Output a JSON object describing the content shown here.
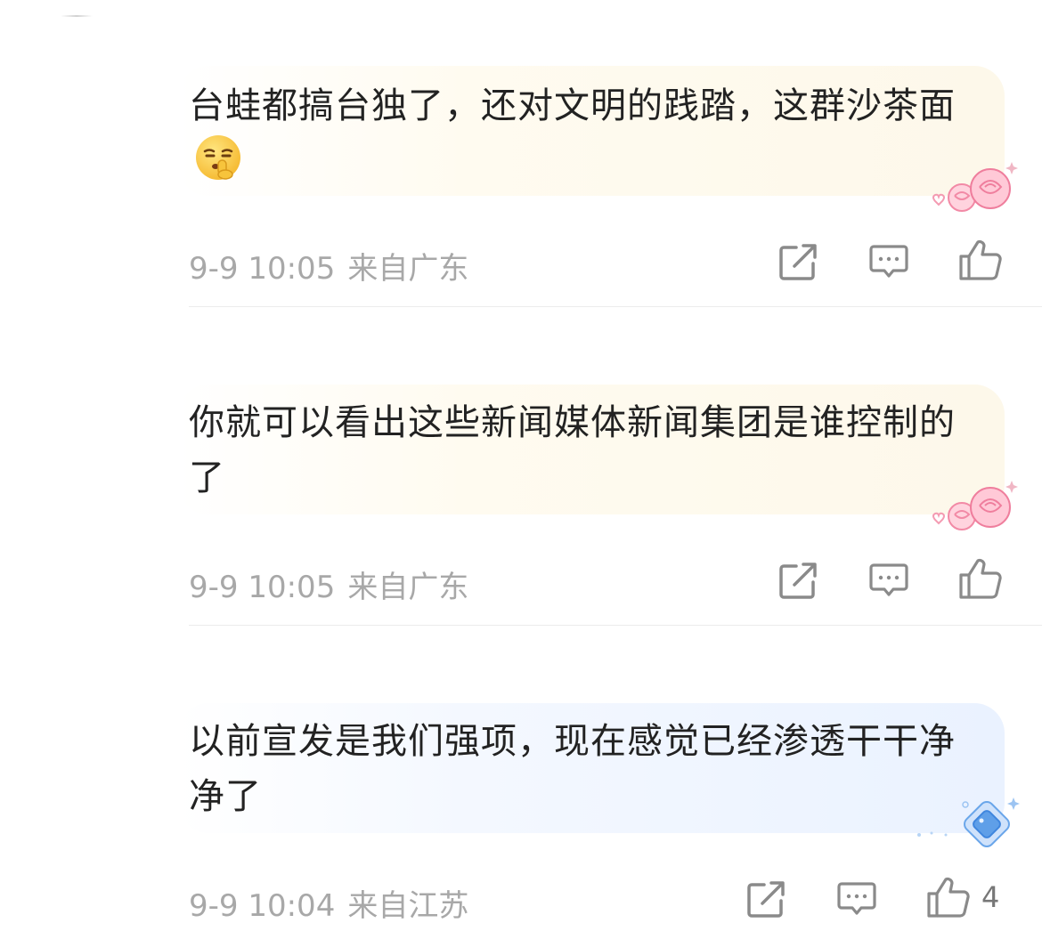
{
  "comments": [
    {
      "text": "台蛙都搞台独了，还对文明的践踏，这群沙茶面",
      "time": "9-9 10:05",
      "location": "来自广东",
      "like_count": "",
      "bubble_style": "rose",
      "emoji": "shushing-face"
    },
    {
      "text": "你就可以看出这些新闻媒体新闻集团是谁控制的了",
      "time": "9-9 10:05",
      "location": "来自广东",
      "like_count": "",
      "bubble_style": "rose"
    },
    {
      "text": "以前宣发是我们强项，现在感觉已经渗透干干净净了",
      "time": "9-9 10:04",
      "location": "来自江苏",
      "like_count": "4",
      "bubble_style": "diamond"
    }
  ],
  "icons": {
    "share": "share-icon",
    "reply": "comment-icon",
    "like": "thumbs-up-icon"
  },
  "colors": {
    "meta_text": "#a8a8a8",
    "icon": "#8a8a8a",
    "bubble_warm": "#fdf8ea",
    "bubble_blue": "#eaf2ff"
  }
}
